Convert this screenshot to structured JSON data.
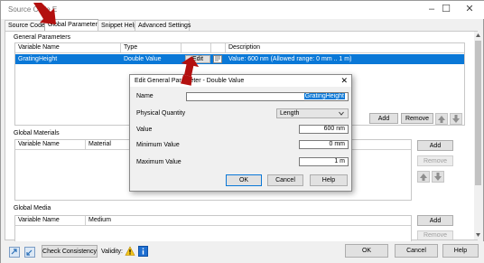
{
  "window": {
    "title": "Source Code E",
    "minimize_glyph": "–",
    "maximize_glyph": "☐",
    "close_glyph": "✕"
  },
  "tabs": [
    {
      "label": "Source Code"
    },
    {
      "label": "Global Parameters"
    },
    {
      "label": "Snippet Help"
    },
    {
      "label": "Advanced Settings"
    }
  ],
  "general_parameters": {
    "title": "General Parameters",
    "columns": [
      "Variable Name",
      "Type",
      "",
      "Description"
    ],
    "rows": [
      {
        "name": "GratingHeight",
        "type": "Double Value",
        "edit_label": "Edit",
        "description": "Value: 600 nm (Allowed range: 0 mm .. 1 m)"
      }
    ],
    "add_label": "Add",
    "remove_label": "Remove"
  },
  "global_materials": {
    "title": "Global Materials",
    "columns": [
      "Variable Name",
      "Material"
    ],
    "add_label": "Add",
    "remove_label": "Remove"
  },
  "global_media": {
    "title": "Global Media",
    "columns": [
      "Variable Name",
      "Medium"
    ],
    "add_label": "Add",
    "remove_label": "Remove"
  },
  "dialog": {
    "title": "Edit General Parameter - Double Value",
    "close_glyph": "✕",
    "name_label": "Name",
    "name_value": "GratingHeight",
    "quantity_label": "Physical Quantity",
    "quantity_value": "Length",
    "value_label": "Value",
    "value_value": "600 nm",
    "min_label": "Minimum Value",
    "min_value": "0 mm",
    "max_label": "Maximum Value",
    "max_value": "1 m",
    "ok_label": "OK",
    "cancel_label": "Cancel",
    "help_label": "Help"
  },
  "bottom": {
    "check_label": "Check Consistency",
    "validity_label": "Validity:",
    "ok_label": "OK",
    "cancel_label": "Cancel",
    "help_label": "Help"
  },
  "colors": {
    "selection": "#0a78d7",
    "annotation_arrow": "#b3100f"
  }
}
